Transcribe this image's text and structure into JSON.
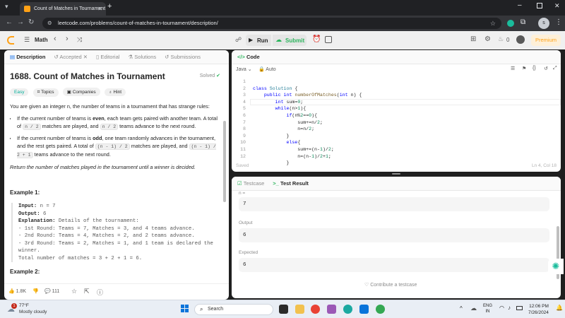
{
  "browser": {
    "tab_title": "Count of Matches in Tournament",
    "url": "leetcode.com/problems/count-of-matches-in-tournament/description/",
    "avatar_letter": "s"
  },
  "nav": {
    "list_label": "Math",
    "run_label": "Run",
    "submit_label": "Submit",
    "fire_count": "0",
    "premium_label": "Premium"
  },
  "left_tabs": [
    "Description",
    "Accepted",
    "Editorial",
    "Solutions",
    "Submissions"
  ],
  "problem": {
    "title": "1688. Count of Matches in Tournament",
    "solved": "Solved",
    "difficulty": "Easy",
    "topics": "Topics",
    "companies": "Companies",
    "hint": "Hint",
    "intro": "You are given an integer n, the number of teams in a tournament that has strange rules:",
    "bullet1_a": "If the current number of teams is ",
    "bullet1_b": "even",
    "bullet1_c": ", each team gets paired with another team. A total of ",
    "bullet1_code1": "n / 2",
    "bullet1_d": " matches are played, and ",
    "bullet1_code2": "n / 2",
    "bullet1_e": " teams advance to the next round.",
    "bullet2_a": "If the current number of teams is ",
    "bullet2_b": "odd",
    "bullet2_c": ", one team randomly advances in the tournament, and the rest gets paired. A total of ",
    "bullet2_code1": "(n - 1) / 2",
    "bullet2_d": " matches are played, and ",
    "bullet2_code2": "(n - 1) / 2 + 1",
    "bullet2_e": " teams advance to the next round.",
    "return_text": "Return the number of matches played in the tournament until a winner is decided.",
    "example1_title": "Example 1:",
    "ex_input_label": "Input:",
    "ex_input": " n = 7",
    "ex_output_label": "Output:",
    "ex_output": " 6",
    "ex_expl_label": "Explanation:",
    "ex_expl": " Details of the tournament:",
    "ex_lines": [
      "- 1st Round: Teams = 7, Matches = 3, and 4 teams advance.",
      "- 2nd Round: Teams = 4, Matches = 2, and 2 teams advance.",
      "- 3rd Round: Teams = 2, Matches = 1, and 1 team is declared the",
      "winner.",
      "Total number of matches = 3 + 2 + 1 = 6."
    ],
    "example2_title": "Example 2:",
    "likes": "1.8K",
    "comments": "111"
  },
  "editor": {
    "header": "Code",
    "language": "Java",
    "mode": "Auto",
    "saved": "Saved",
    "cursor": "Ln 4, Col 18",
    "line_numbers": [
      "1",
      "2",
      "3",
      "4",
      "5",
      "6",
      "7",
      "8",
      "9",
      "10",
      "11",
      "12"
    ]
  },
  "console": {
    "tab_testcase": "Testcase",
    "tab_result": "Test Result",
    "input_label": "n =",
    "input_value": "7",
    "output_label": "Output",
    "output_value": "6",
    "expected_label": "Expected",
    "expected_value": "6",
    "contribute": "Contribute a testcase"
  },
  "taskbar": {
    "weather_temp": "77°F",
    "weather_desc": "Mostly cloudy",
    "notif_count": "1",
    "search_placeholder": "Search",
    "lang1": "ENG",
    "lang2": "IN",
    "time": "12:06 PM",
    "date": "7/26/2024"
  }
}
